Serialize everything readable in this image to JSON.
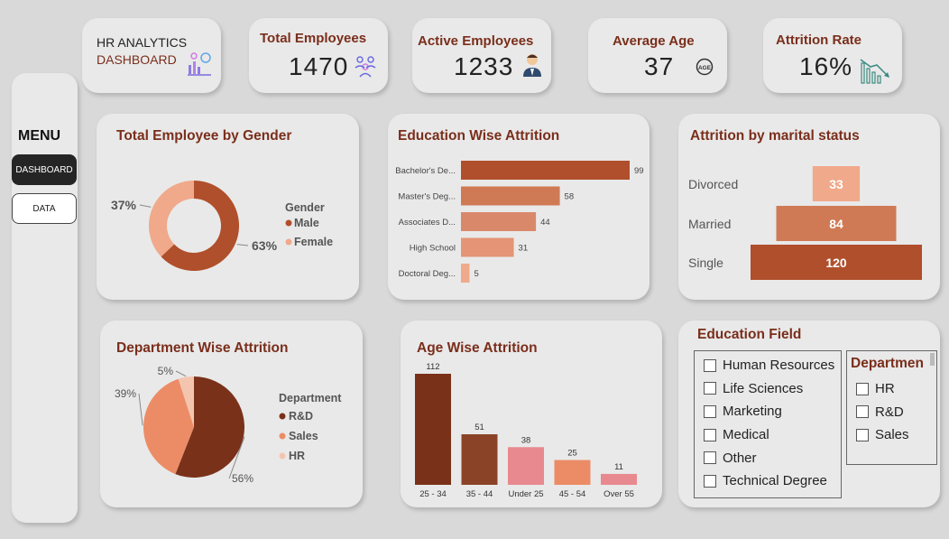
{
  "header": {
    "line1": "HR ANALYTICS",
    "line2": "DASHBOARD"
  },
  "kpis": [
    {
      "id": "total",
      "title": "Total Employees",
      "value": "1470",
      "icon": "people-group-icon"
    },
    {
      "id": "active",
      "title": "Active Employees",
      "value": "1233",
      "icon": "employee-icon"
    },
    {
      "id": "age",
      "title": "Average Age",
      "value": "37",
      "icon": "age-icon"
    },
    {
      "id": "attrition",
      "title": "Attrition Rate",
      "value": "16%",
      "icon": "decline-chart-icon"
    }
  ],
  "menu": {
    "title": "MENU",
    "items": [
      "DASHBOARD",
      "DATA"
    ],
    "active": "DASHBOARD"
  },
  "colors": {
    "dark": "#7a2e1b",
    "primary": "#b04f2b",
    "mid": "#cf7a55",
    "light": "#f0a98a",
    "salmon": "#ec8c66",
    "pink": "#e8898f",
    "hr": "#f4c5ae"
  },
  "chart_data": [
    {
      "id": "gender",
      "type": "pie",
      "title": "Total Employee by Gender",
      "legend_title": "Gender",
      "legend_position": "right",
      "categories": [
        "Male",
        "Female"
      ],
      "values": [
        63,
        37
      ],
      "labels": [
        "63%",
        "37%"
      ],
      "colors": [
        "#b04f2b",
        "#f0a98a"
      ]
    },
    {
      "id": "education",
      "type": "bar",
      "orientation": "horizontal",
      "title": "Education Wise Attrition",
      "categories": [
        "Bachelor's De...",
        "Master's Deg...",
        "Associates D...",
        "High School",
        "Doctoral Deg..."
      ],
      "values": [
        99,
        58,
        44,
        31,
        5
      ],
      "colors": [
        "#b04f2b",
        "#cf7a55",
        "#d9896a",
        "#e59475",
        "#f0a98a"
      ],
      "xlim": [
        0,
        99
      ]
    },
    {
      "id": "marital",
      "type": "bar",
      "orientation": "horizontal",
      "title": "Attrition by marital status",
      "categories": [
        "Divorced",
        "Married",
        "Single"
      ],
      "values": [
        33,
        84,
        120
      ],
      "colors": [
        "#f0a98a",
        "#cf7a55",
        "#b04f2b"
      ],
      "xlim": [
        0,
        120
      ]
    },
    {
      "id": "department",
      "type": "pie",
      "title": "Department Wise Attrition",
      "legend_title": "Department",
      "legend_position": "right",
      "categories": [
        "R&D",
        "Sales",
        "HR"
      ],
      "values": [
        56,
        39,
        5
      ],
      "labels": [
        "56%",
        "39%",
        "5%"
      ],
      "colors": [
        "#7a3119",
        "#ec8c66",
        "#f4c5ae"
      ]
    },
    {
      "id": "age",
      "type": "bar",
      "title": "Age Wise Attrition",
      "categories": [
        "25 - 34",
        "35 - 44",
        "Under 25",
        "45 - 54",
        "Over 55"
      ],
      "values": [
        112,
        51,
        38,
        25,
        11
      ],
      "colors": [
        "#7a3119",
        "#8b4327",
        "#e8898f",
        "#ec8c66",
        "#e8898f"
      ],
      "ylim": [
        0,
        112
      ]
    }
  ],
  "slicers": {
    "education_field": {
      "title": "Education Field",
      "items": [
        "Human Resources",
        "Life Sciences",
        "Marketing",
        "Medical",
        "Other",
        "Technical Degree"
      ]
    },
    "department": {
      "title": "Departmen",
      "items": [
        "HR",
        "R&D",
        "Sales"
      ]
    }
  }
}
